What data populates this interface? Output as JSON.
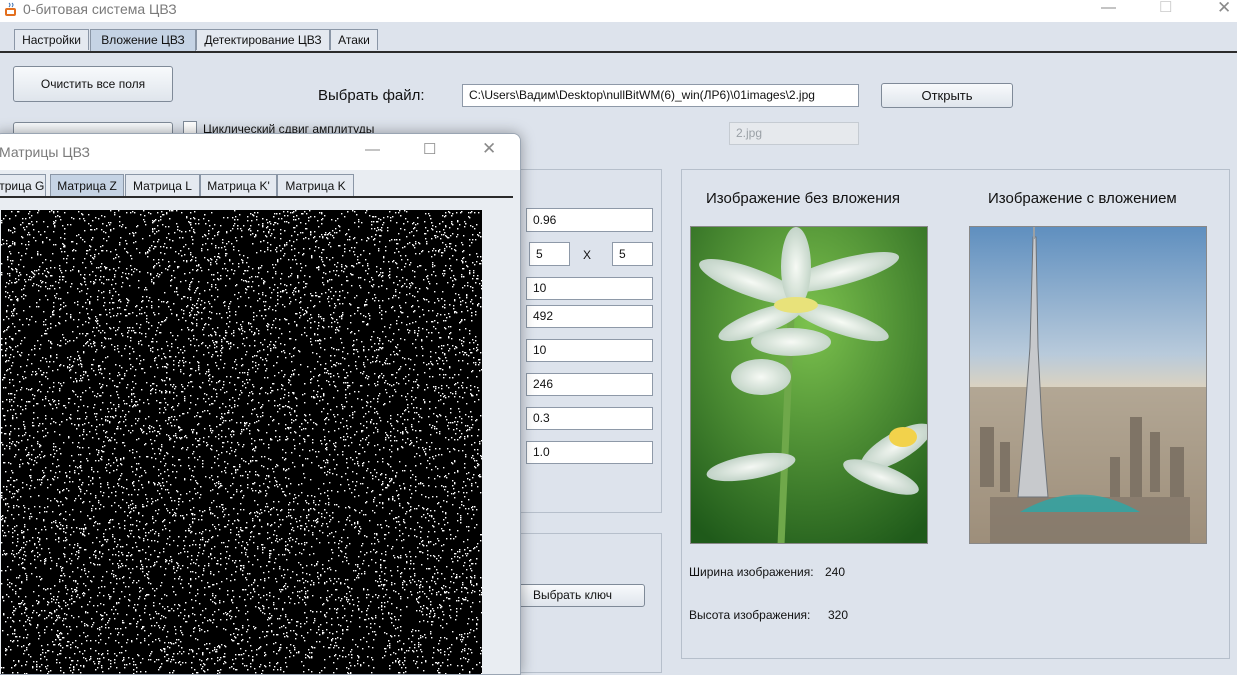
{
  "window": {
    "title": "0-битовая система ЦВЗ",
    "minimize": "—",
    "maximize": "☐",
    "close": "✕"
  },
  "tabs": [
    "Настройки",
    "Вложение ЦВЗ",
    "Детектирование ЦВЗ",
    "Атаки"
  ],
  "toolbar": {
    "clear_button": "Очистить все поля",
    "select_file_label": "Выбрать файл:",
    "file_path": "C:\\Users\\Вадим\\Desktop\\nullBitWM(6)_win(ЛР6)\\01images\\2.jpg",
    "open_button": "Открыть",
    "file_name": "2.jpg",
    "cyclic_shift_label": "Циклический сдвиг амплитуды"
  },
  "params": {
    "p1": "0.96",
    "block_w": "5",
    "x_sep": "X",
    "block_h": "5",
    "p3": "10",
    "p4": "492",
    "p5": "10",
    "p6": "246",
    "p7": "0.3",
    "p8": "1.0"
  },
  "key": {
    "select_key_button": "Выбрать ключ"
  },
  "images": {
    "original_caption": "Изображение без вложения",
    "watermarked_caption": "Изображение с вложением",
    "width_label": "Ширина изображения:",
    "width_value": "240",
    "height_label": "Высота изображения:",
    "height_value": "320"
  },
  "child": {
    "title": "Матрицы ЦВЗ",
    "minimize": "—",
    "maximize": "☐",
    "close": "✕",
    "tabs": [
      "Матрица G",
      "Матрица Z",
      "Матрица L",
      "Матрица K'",
      "Матрица K"
    ]
  }
}
